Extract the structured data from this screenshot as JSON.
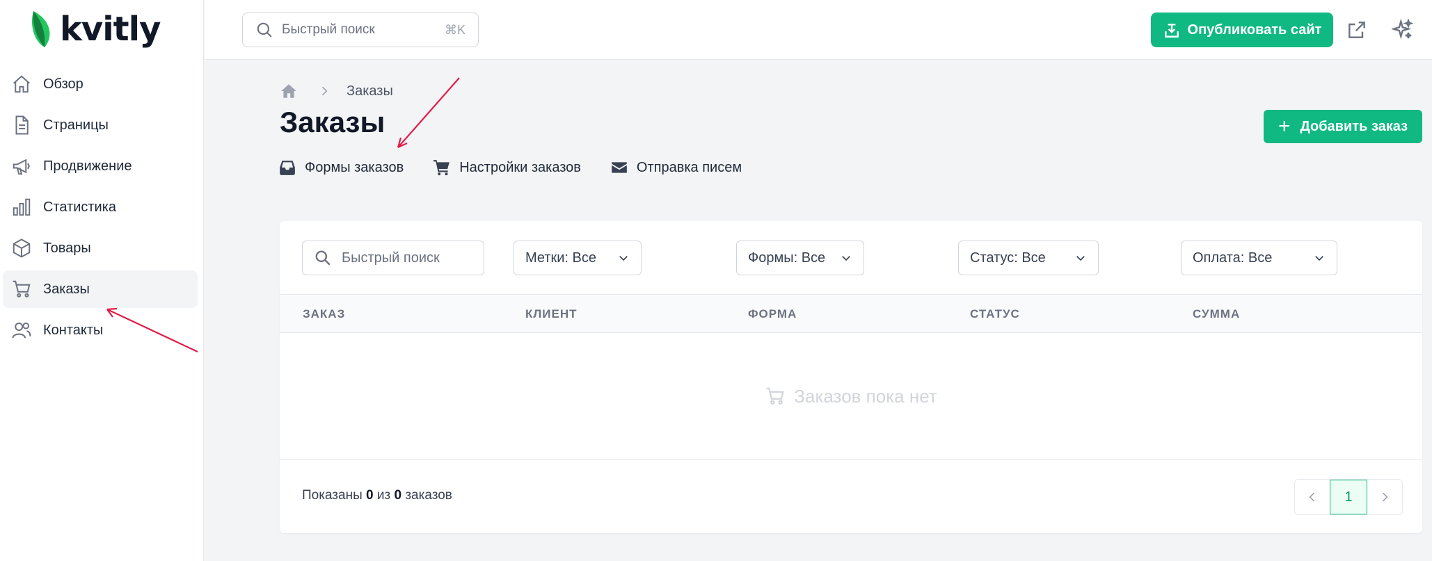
{
  "app": {
    "name": "kvitly",
    "brand_color": "#10b981"
  },
  "sidebar": {
    "items": [
      {
        "label": "Обзор",
        "icon": "home-icon"
      },
      {
        "label": "Страницы",
        "icon": "document-icon"
      },
      {
        "label": "Продвижение",
        "icon": "megaphone-icon"
      },
      {
        "label": "Статистика",
        "icon": "bar-chart-icon"
      },
      {
        "label": "Товары",
        "icon": "cube-icon"
      },
      {
        "label": "Заказы",
        "icon": "cart-icon",
        "active": true
      },
      {
        "label": "Контакты",
        "icon": "users-icon"
      }
    ]
  },
  "topbar": {
    "search_placeholder": "Быстрый поиск",
    "search_shortcut": "⌘K",
    "publish_label": "Опубликовать сайт"
  },
  "breadcrumb": {
    "current": "Заказы"
  },
  "page": {
    "title": "Заказы",
    "add_label": "Добавить заказ",
    "subnav": [
      {
        "label": "Формы заказов",
        "icon": "inbox-icon"
      },
      {
        "label": "Настройки заказов",
        "icon": "cart-icon"
      },
      {
        "label": "Отправка писем",
        "icon": "envelope-icon"
      }
    ]
  },
  "filters": {
    "search_placeholder": "Быстрый поиск",
    "tags": "Метки: Все",
    "forms": "Формы: Все",
    "status": "Статус: Все",
    "payment": "Оплата: Все"
  },
  "table": {
    "columns": [
      "ЗАКАЗ",
      "КЛИЕНТ",
      "ФОРМА",
      "СТАТУС",
      "СУММА"
    ],
    "empty_text": "Заказов пока нет"
  },
  "footer": {
    "shown_prefix": "Показаны",
    "shown_from": "0",
    "shown_mid": "из",
    "shown_total": "0",
    "shown_suffix": "заказов",
    "current_page": "1"
  }
}
